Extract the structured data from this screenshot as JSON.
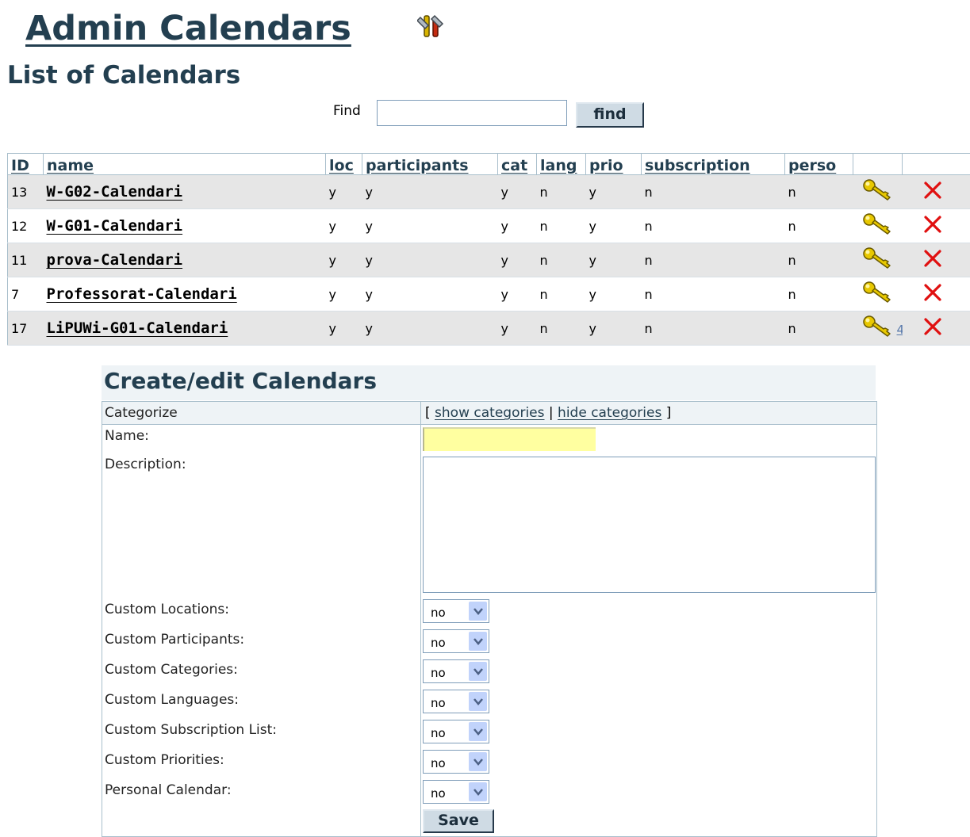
{
  "header": {
    "title": "Admin Calendars",
    "section_title": "List of Calendars"
  },
  "search": {
    "label": "Find",
    "value": "",
    "button": "find"
  },
  "table": {
    "columns": [
      "ID",
      "name",
      "loc",
      "participants",
      "cat",
      "lang",
      "prio",
      "subscription",
      "perso"
    ],
    "rows": [
      {
        "id": "13",
        "name": "W-G02-Calendari",
        "loc": "y",
        "participants": "y",
        "cat": "y",
        "lang": "n",
        "prio": "y",
        "subscription": "n",
        "perso": "n",
        "key_count": ""
      },
      {
        "id": "12",
        "name": "W-G01-Calendari",
        "loc": "y",
        "participants": "y",
        "cat": "y",
        "lang": "n",
        "prio": "y",
        "subscription": "n",
        "perso": "n",
        "key_count": ""
      },
      {
        "id": "11",
        "name": "prova-Calendari",
        "loc": "y",
        "participants": "y",
        "cat": "y",
        "lang": "n",
        "prio": "y",
        "subscription": "n",
        "perso": "n",
        "key_count": ""
      },
      {
        "id": "7",
        "name": "Professorat-Calendari",
        "loc": "y",
        "participants": "y",
        "cat": "y",
        "lang": "n",
        "prio": "y",
        "subscription": "n",
        "perso": "n",
        "key_count": ""
      },
      {
        "id": "17",
        "name": "LiPUWi-G01-Calendari",
        "loc": "y",
        "participants": "y",
        "cat": "y",
        "lang": "n",
        "prio": "y",
        "subscription": "n",
        "perso": "n",
        "key_count": "4"
      }
    ],
    "row_icons": [
      "key-icon",
      "delete-icon",
      "edit-icon"
    ]
  },
  "form": {
    "title": "Create/edit Calendars",
    "categorize_label": "Categorize",
    "categorize_open": "[",
    "show_categories": "show categories",
    "separator": "|",
    "hide_categories": "hide categories",
    "categorize_close": "]",
    "name_label": "Name:",
    "name_value": "",
    "description_label": "Description:",
    "description_value": "",
    "selects": [
      {
        "label": "Custom Locations:",
        "value": "no"
      },
      {
        "label": "Custom Participants:",
        "value": "no"
      },
      {
        "label": "Custom Categories:",
        "value": "no"
      },
      {
        "label": "Custom Languages:",
        "value": "no"
      },
      {
        "label": "Custom Subscription List:",
        "value": "no"
      },
      {
        "label": "Custom Priorities:",
        "value": "no"
      },
      {
        "label": "Personal Calendar:",
        "value": "no"
      }
    ],
    "save": "Save"
  },
  "colors": {
    "heading": "#233f50",
    "odd_row": "#e6e6e6",
    "name_field": "#ffffa0",
    "delete": "#e01010"
  }
}
